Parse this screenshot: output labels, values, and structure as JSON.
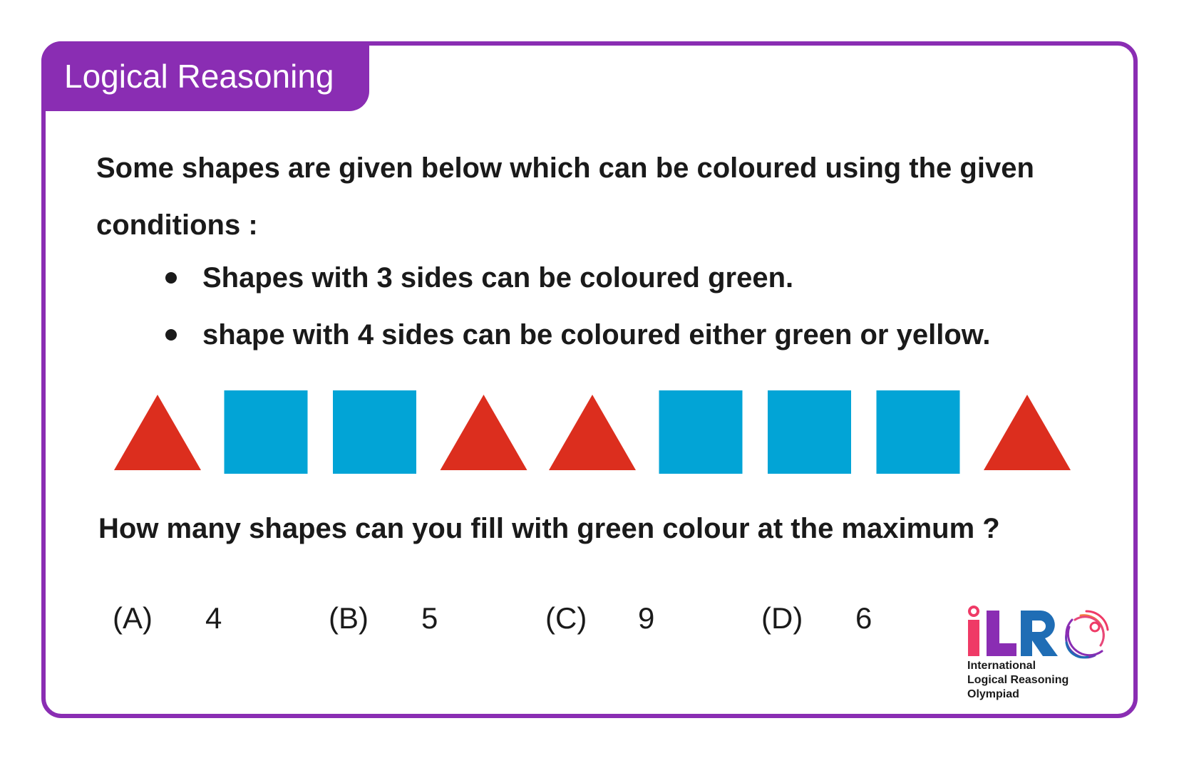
{
  "header": {
    "category_label": "Logical Reasoning"
  },
  "question": {
    "intro": "Some shapes are given below which can be coloured using the given conditions :",
    "conditions": [
      "Shapes with 3 sides can be coloured green.",
      "shape with 4 sides can be coloured either green or yellow."
    ],
    "shapes": [
      {
        "type": "triangle",
        "color": "#dc2e1e"
      },
      {
        "type": "square",
        "color": "#02a4d6"
      },
      {
        "type": "square",
        "color": "#02a4d6"
      },
      {
        "type": "triangle",
        "color": "#dc2e1e"
      },
      {
        "type": "triangle",
        "color": "#dc2e1e"
      },
      {
        "type": "square",
        "color": "#02a4d6"
      },
      {
        "type": "square",
        "color": "#02a4d6"
      },
      {
        "type": "square",
        "color": "#02a4d6"
      },
      {
        "type": "triangle",
        "color": "#dc2e1e"
      }
    ],
    "prompt": "How many shapes can you fill with green colour at the maximum ?",
    "options": [
      {
        "letter": "(A)",
        "value": "4"
      },
      {
        "letter": "(B)",
        "value": "5"
      },
      {
        "letter": "(C)",
        "value": "9"
      },
      {
        "letter": "(D)",
        "value": "6"
      }
    ]
  },
  "branding": {
    "logo_letters": [
      "i",
      "L",
      "R",
      "O"
    ],
    "logo_colors": {
      "i": "#ef3a66",
      "L": "#8a2db3",
      "R": "#1f6db5"
    },
    "name_lines": [
      "International",
      "Logical Reasoning",
      "Olympiad"
    ]
  },
  "theme": {
    "accent": "#8a2db3",
    "triangle": "#dc2e1e",
    "square": "#02a4d6"
  }
}
